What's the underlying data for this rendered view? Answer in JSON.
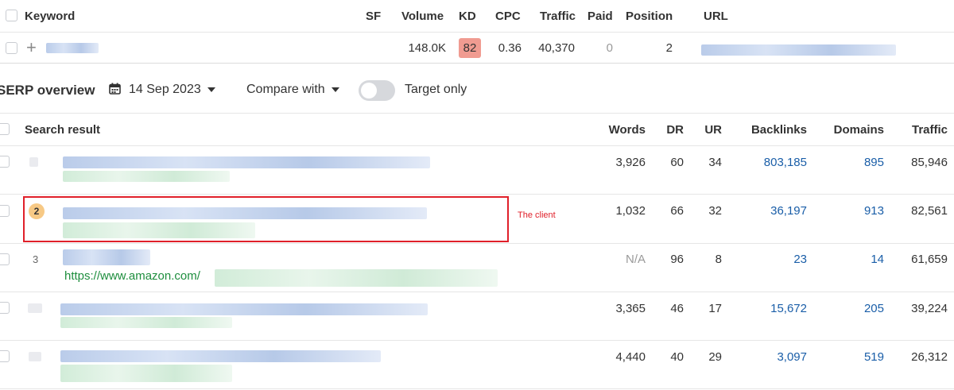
{
  "keyword_table": {
    "headers": {
      "keyword": "Keyword",
      "sf": "SF",
      "volume": "Volume",
      "kd": "KD",
      "cpc": "CPC",
      "traffic": "Traffic",
      "paid": "Paid",
      "position": "Position",
      "url": "URL"
    },
    "row": {
      "add_icon": "+",
      "volume": "148.0K",
      "kd": "82",
      "cpc": "0.36",
      "traffic": "40,370",
      "paid": "0",
      "position": "2"
    }
  },
  "serp_toolbar": {
    "title": "SERP overview",
    "date": "14 Sep 2023",
    "compare_label": "Compare with",
    "target_only_label": "Target only",
    "target_only_enabled": false
  },
  "serp_table": {
    "headers": {
      "search_result": "Search result",
      "words": "Words",
      "dr": "DR",
      "ur": "UR",
      "backlinks": "Backlinks",
      "domains": "Domains",
      "traffic": "Traffic"
    },
    "rows": [
      {
        "rank": "",
        "url": "",
        "words": "3,926",
        "dr": "60",
        "ur": "34",
        "backlinks": "803,185",
        "domains": "895",
        "traffic": "85,946"
      },
      {
        "rank": "2",
        "url": "",
        "words": "1,032",
        "dr": "66",
        "ur": "32",
        "backlinks": "36,197",
        "domains": "913",
        "traffic": "82,561",
        "annotation": "The client"
      },
      {
        "rank": "3",
        "url": "https://www.amazon.com/",
        "words": "N/A",
        "dr": "96",
        "ur": "8",
        "backlinks": "23",
        "domains": "14",
        "traffic": "61,659"
      },
      {
        "rank": "",
        "url": "",
        "words": "3,365",
        "dr": "46",
        "ur": "17",
        "backlinks": "15,672",
        "domains": "205",
        "traffic": "39,224"
      },
      {
        "rank": "",
        "url": "",
        "words": "4,440",
        "dr": "40",
        "ur": "29",
        "backlinks": "3,097",
        "domains": "519",
        "traffic": "26,312"
      }
    ]
  },
  "colors": {
    "kd_badge": "#f09b91",
    "link": "#1a5ea8",
    "client_highlight": "#e0202a",
    "rank_badge": "#f7c985",
    "url_green": "#1e8e3e"
  }
}
